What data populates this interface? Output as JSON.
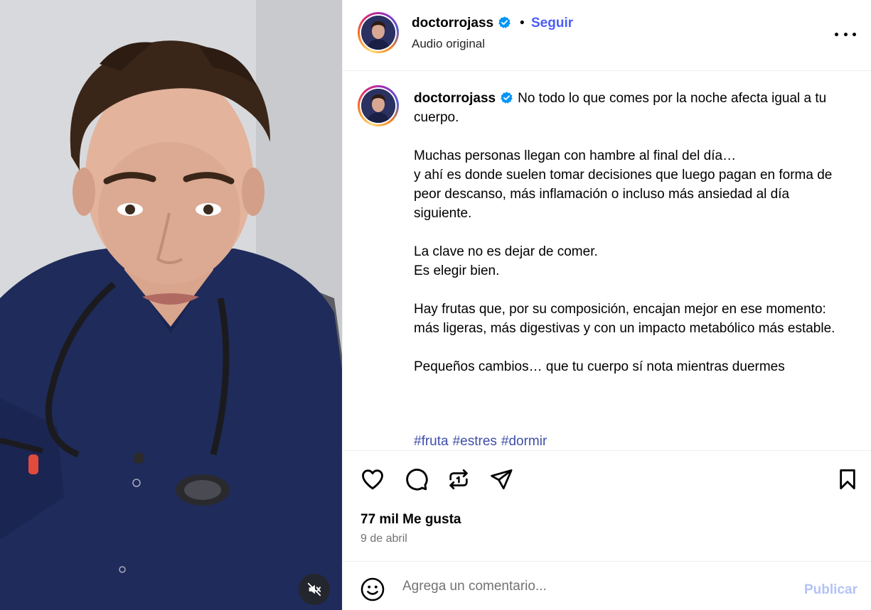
{
  "post": {
    "username": "doctorrojass",
    "separator": "•",
    "follow_label": "Seguir",
    "audio_label": "Audio original"
  },
  "caption": {
    "username": "doctorrojass",
    "text": "No todo lo que comes por la noche afecta igual a tu cuerpo.\n\nMuchas personas llegan con hambre al final del día…\ny ahí es donde suelen tomar decisiones que luego pagan en forma de peor descanso, más inflamación o incluso más ansiedad al día siguiente.\n\nLa clave no es dejar de comer.\nEs elegir bien.\n\nHay frutas que, por su composición, encajan mejor en ese momento:\nmás ligeras, más digestivas y con un impacto metabólico más estable.\n\nPequeños cambios… que tu cuerpo sí nota mientras duermes",
    "hashtags": [
      "#fruta",
      "#estres",
      "#dormir"
    ]
  },
  "stats": {
    "likes": "77 mil Me gusta",
    "date": "9 de abril"
  },
  "comment_box": {
    "placeholder": "Agrega un comentario...",
    "publish_label": "Publicar"
  },
  "icons": {
    "like": "heart-icon",
    "comment": "comment-icon",
    "repost": "repost-icon",
    "share": "send-icon",
    "save": "bookmark-icon",
    "emoji": "emoji-icon",
    "mute": "muted-speaker-icon",
    "verified": "verified-badge-icon",
    "more": "more-options-icon"
  },
  "colors": {
    "accent_link": "#4a5df9",
    "hashtag": "#3e4ea8",
    "publish_disabled": "#b3c3f5",
    "verified": "#0095f6"
  }
}
